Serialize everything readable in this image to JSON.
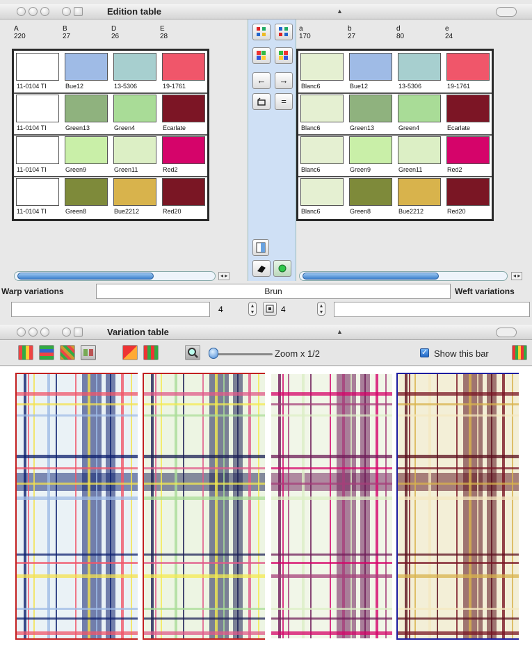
{
  "edition_window": {
    "title": "Edition table",
    "warp_columns": [
      {
        "letter": "A",
        "count": "220"
      },
      {
        "letter": "B",
        "count": "27"
      },
      {
        "letter": "D",
        "count": "26"
      },
      {
        "letter": "E",
        "count": "28"
      }
    ],
    "weft_columns": [
      {
        "letter": "a",
        "count": "170"
      },
      {
        "letter": "b",
        "count": "27"
      },
      {
        "letter": "d",
        "count": "80"
      },
      {
        "letter": "e",
        "count": "24"
      }
    ],
    "warp_rows": [
      [
        {
          "label": "11-0104 TI",
          "color": "#ffffff"
        },
        {
          "label": "Bue12",
          "color": "#9fbbe6"
        },
        {
          "label": "13-5306",
          "color": "#a7cfcf"
        },
        {
          "label": "19-1761",
          "color": "#f0566a"
        }
      ],
      [
        {
          "label": "11-0104 TI",
          "color": "#ffffff"
        },
        {
          "label": "Green13",
          "color": "#8fb27e"
        },
        {
          "label": "Green4",
          "color": "#a9dc97"
        },
        {
          "label": "Ecarlate",
          "color": "#7c1525"
        }
      ],
      [
        {
          "label": "11-0104 TI",
          "color": "#ffffff"
        },
        {
          "label": "Green9",
          "color": "#c9efa8"
        },
        {
          "label": "Green11",
          "color": "#dcefc5"
        },
        {
          "label": "Red2",
          "color": "#d5046a"
        }
      ],
      [
        {
          "label": "11-0104 TI",
          "color": "#ffffff"
        },
        {
          "label": "Green8",
          "color": "#7e8a3a"
        },
        {
          "label": "Bue2212",
          "color": "#d8b34c"
        },
        {
          "label": "Red20",
          "color": "#7a1624"
        }
      ]
    ],
    "weft_rows": [
      [
        {
          "label": "Blanc6",
          "color": "#e5f0d2"
        },
        {
          "label": "Bue12",
          "color": "#9fbbe6"
        },
        {
          "label": "13-5306",
          "color": "#a7cfcf"
        },
        {
          "label": "19-1761",
          "color": "#f0566a"
        }
      ],
      [
        {
          "label": "Blanc6",
          "color": "#e5f0d2"
        },
        {
          "label": "Green13",
          "color": "#8fb27e"
        },
        {
          "label": "Green4",
          "color": "#a9dc97"
        },
        {
          "label": "Ecarlate",
          "color": "#7c1525"
        }
      ],
      [
        {
          "label": "Blanc6",
          "color": "#e5f0d2"
        },
        {
          "label": "Green9",
          "color": "#c9efa8"
        },
        {
          "label": "Green11",
          "color": "#dcefc5"
        },
        {
          "label": "Red2",
          "color": "#d5046a"
        }
      ],
      [
        {
          "label": "Blanc6",
          "color": "#e5f0d2"
        },
        {
          "label": "Green8",
          "color": "#7e8a3a"
        },
        {
          "label": "Bue2212",
          "color": "#d8b34c"
        },
        {
          "label": "Red20",
          "color": "#7a1624"
        }
      ]
    ],
    "arrow_left": "←",
    "arrow_right": "→",
    "equal_sign": "=",
    "warp_label": "Warp variations",
    "weft_label": "Weft variations",
    "center_name": "Brun",
    "warp_count": "4",
    "weft_count": "4"
  },
  "variation_window": {
    "title": "Variation table",
    "zoom_label": "Zoom x 1/2",
    "show_bar_label": "Show this bar",
    "show_bar_checked": true,
    "accent": "#2066c4",
    "variations": [
      {
        "frame": "#c22020",
        "ground": "#eaf2f6",
        "bands": [
          "#0c1f6e",
          "#f0566a",
          "#f4e24e",
          "#9fbbe6"
        ]
      },
      {
        "frame": "#c22020",
        "ground": "#edf5e3",
        "bands": [
          "#1b1f55",
          "#e05a8a",
          "#f4ea50",
          "#a9dc97"
        ]
      },
      {
        "frame": "#ffffff",
        "ground": "#f1f6e8",
        "bands": [
          "#6e1c58",
          "#d5046a",
          "#a6407a",
          "#dcefc5"
        ]
      },
      {
        "frame": "#1c1ca0",
        "ground": "#f3efd7",
        "bands": [
          "#5a0e1c",
          "#7a1624",
          "#d8b34c",
          "#f4e8c0"
        ]
      }
    ]
  }
}
